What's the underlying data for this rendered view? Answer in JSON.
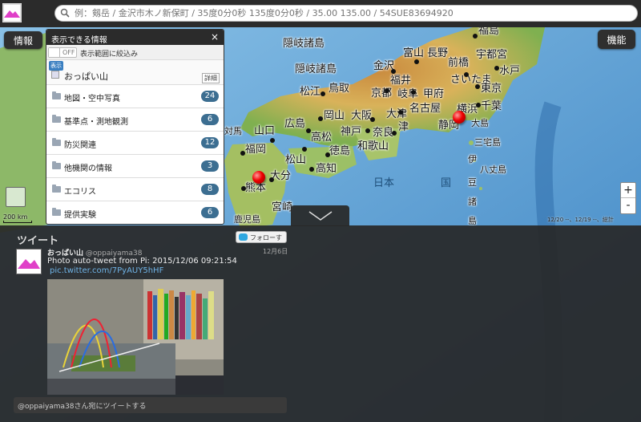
{
  "search": {
    "placeholder": "例：剱岳 / 金沢市木ノ新保町 / 35度0分0秒 135度0分0秒 / 35.00 135.00 / 54SUE83694920"
  },
  "buttons": {
    "info": "情報",
    "functions": "機能"
  },
  "panel": {
    "title": "表示できる情報",
    "close": "×",
    "toggle_state": "OFF",
    "filter_label": "表示範囲に絞込み",
    "shown_tag": "表示",
    "shown_layer": "おっぱい山",
    "detail": "詳細",
    "categories": [
      {
        "label": "地図・空中写真",
        "count": "24"
      },
      {
        "label": "基準点・測地観測",
        "count": "6"
      },
      {
        "label": "防災関連",
        "count": "12"
      },
      {
        "label": "他機関の情報",
        "count": "3"
      },
      {
        "label": "エコリス",
        "count": "8"
      },
      {
        "label": "提供実験",
        "count": "6"
      }
    ]
  },
  "map": {
    "scale": "200 km",
    "credits": "12/20 --、12/19 --、総計",
    "zoom_in": "+",
    "zoom_out": "-",
    "cities": {
      "fukushima": "福島",
      "oki": "隠岐諸島",
      "matsue": "松江",
      "tottori": "鳥取",
      "kanazawa": "金沢",
      "toyama": "富山",
      "nagano": "長野",
      "maebashi": "前橋",
      "utsunomiya": "宇都宮",
      "mito": "水戸",
      "fukui": "福井",
      "saitama": "さいたま",
      "tokyo": "東京",
      "chiba": "千葉",
      "yokohama": "横浜",
      "kyoto": "京都",
      "otsu": "大津",
      "gifu": "岐阜",
      "kofu": "甲府",
      "nagoya": "名古屋",
      "shizuoka": "静岡",
      "hiroshima": "広島",
      "okayama": "岡山",
      "osaka": "大阪",
      "kobe": "神戸",
      "nara": "奈良",
      "tsu": "津",
      "wakayama": "和歌山",
      "yamaguchi": "山口",
      "fukuoka": "福岡",
      "takamatsu": "高松",
      "tokushima": "徳島",
      "matsuyama": "松山",
      "kochi": "高知",
      "oita": "大分",
      "kumamoto": "熊本",
      "miyazaki": "宮崎",
      "oshima": "大島",
      "miyake": "三宅島",
      "hachijo": "八丈島",
      "tsushima": "対馬",
      "nihon": "日本",
      "koku": "国",
      "i": "伊",
      "zu": "豆",
      "sho": "諸",
      "to": "島",
      "kagoshima": "鹿児島"
    }
  },
  "tweets": {
    "title": "ツイート",
    "follow": "フォローする",
    "author": "おっぱい山",
    "handle": "@oppaiyama38",
    "date": "12月6日",
    "text": "Photo auto-tweet from Pi: 2015/12/06 09:21:54",
    "link": "pic.twitter.com/7PyAUY5hHF",
    "reply_placeholder": "@oppaiyama38さん宛にツイートする"
  }
}
